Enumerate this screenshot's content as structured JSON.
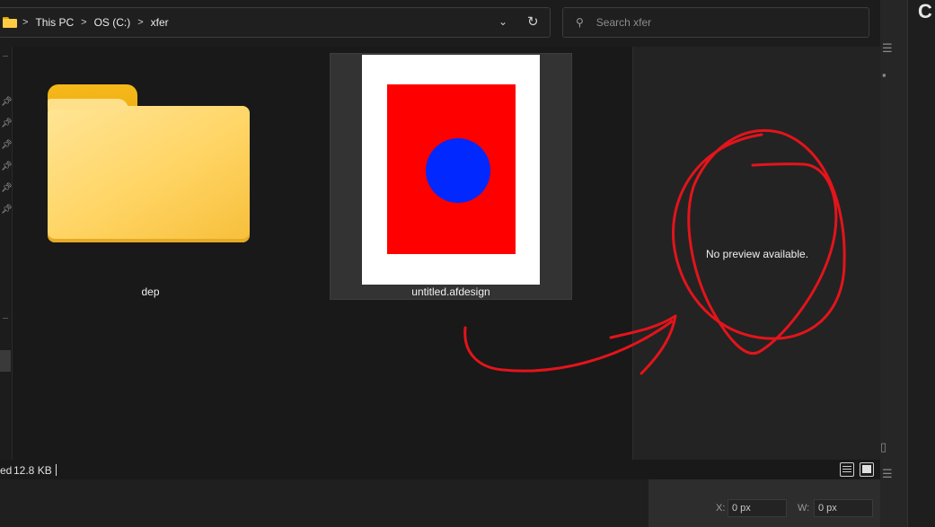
{
  "address": {
    "crumbs": [
      "This PC",
      "OS (C:)",
      "xfer"
    ],
    "separator": ">",
    "dropdown_icon": "chevron-down-icon",
    "refresh_icon": "refresh-icon"
  },
  "search": {
    "placeholder": "Search xfer",
    "icon": "search-icon"
  },
  "files": [
    {
      "name": "dep",
      "type": "folder"
    },
    {
      "name": "untitled.afdesign",
      "type": "file"
    }
  ],
  "preview": {
    "message": "No preview available."
  },
  "status": {
    "left_text": "ed",
    "size": "12.8 KB"
  },
  "background_app": {
    "title_letter": "C",
    "fields": [
      {
        "label": "X:",
        "value": "0 px"
      },
      {
        "label": "W:",
        "value": "0 px"
      }
    ]
  },
  "colors": {
    "annotation": "#e3141b",
    "thumbnail_rect": "#ff0000",
    "thumbnail_circle": "#0028ff"
  }
}
